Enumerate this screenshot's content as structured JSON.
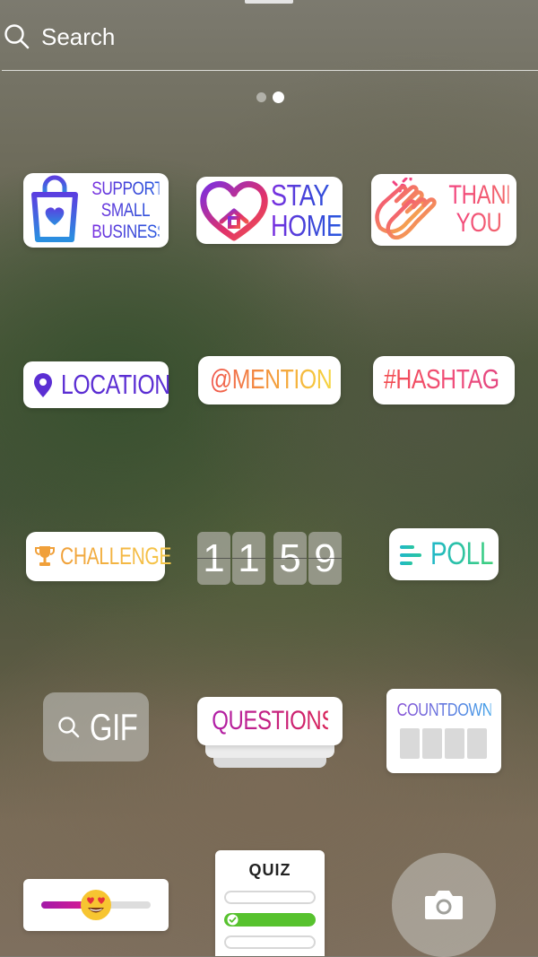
{
  "search": {
    "placeholder": "Search"
  },
  "pager": {
    "pages": 2,
    "active": 2
  },
  "stickers": {
    "support_small_business": {
      "lines": [
        "SUPPORT",
        "SMALL",
        "BUSINESS"
      ]
    },
    "stay_home": {
      "lines": [
        "STAY",
        "HOME"
      ]
    },
    "thank_you": {
      "lines": [
        "THANK",
        "YOU"
      ]
    },
    "location": {
      "label": "LOCATION"
    },
    "mention": {
      "label": "@MENTION"
    },
    "hashtag": {
      "label": "#HASHTAG"
    },
    "challenge": {
      "label": "CHALLENGE"
    },
    "time": {
      "digits": [
        "1",
        "1",
        "5",
        "9"
      ]
    },
    "poll": {
      "label": "POLL"
    },
    "gif": {
      "label": "GIF"
    },
    "questions": {
      "label": "QUESTIONS"
    },
    "countdown": {
      "label": "COUNTDOWN"
    },
    "emoji_slider": {
      "value": 0.5,
      "emoji": "😍"
    },
    "quiz": {
      "label": "QUIZ",
      "options": 3,
      "correct_option": 2
    }
  },
  "icons": {
    "search": "search-icon",
    "shopping_bag": "shopping-bag-icon",
    "heart_house": "heart-house-icon",
    "clapping_hands": "clapping-hands-icon",
    "location_pin": "location-pin-icon",
    "trophy": "trophy-icon",
    "poll": "poll-lines-icon",
    "gif_search": "search-icon",
    "camera": "camera-icon",
    "check": "check-icon"
  },
  "colors": {
    "location_purple": "#5b2ed3",
    "quiz_correct": "#57c22e",
    "slider_fill": "#c01a9c"
  }
}
